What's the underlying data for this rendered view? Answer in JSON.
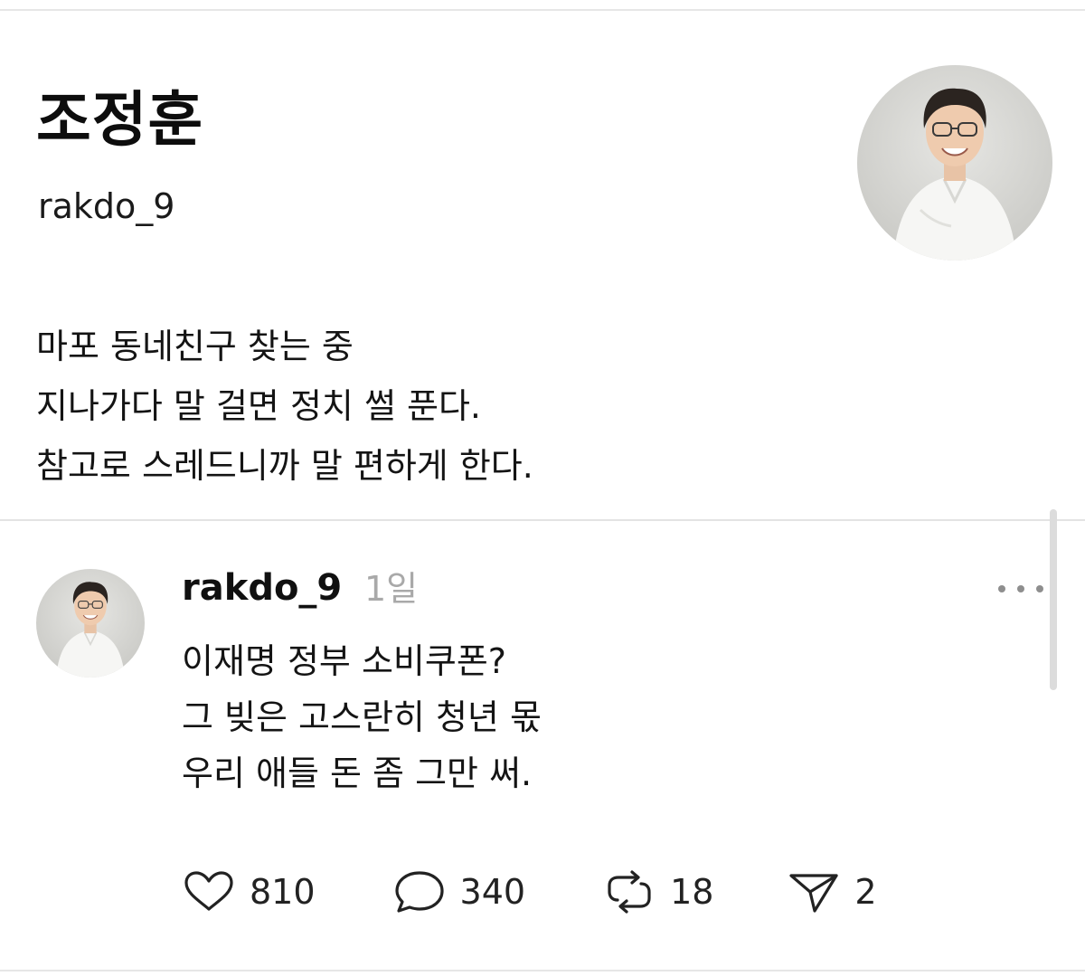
{
  "profile": {
    "display_name": "조정훈",
    "handle": "rakdo_9",
    "bio": [
      "마포 동네친구 찾는 중",
      "지나가다 말 걸면 정치 썰 푼다.",
      "참고로 스레드니까 말 편하게 한다."
    ]
  },
  "post": {
    "author": "rakdo_9",
    "time": "1일",
    "body": [
      "이재명 정부 소비쿠폰?",
      "그 빚은 고스란히 청년 몫",
      "우리 애들 돈 좀 그만 써."
    ],
    "actions": {
      "likes": "810",
      "replies": "340",
      "reposts": "18",
      "shares": "2"
    }
  },
  "icons": {
    "like": "heart-icon",
    "reply": "speech-bubble-icon",
    "repost": "repost-arrows-icon",
    "share": "paper-plane-icon",
    "more": "more-dots-icon"
  }
}
